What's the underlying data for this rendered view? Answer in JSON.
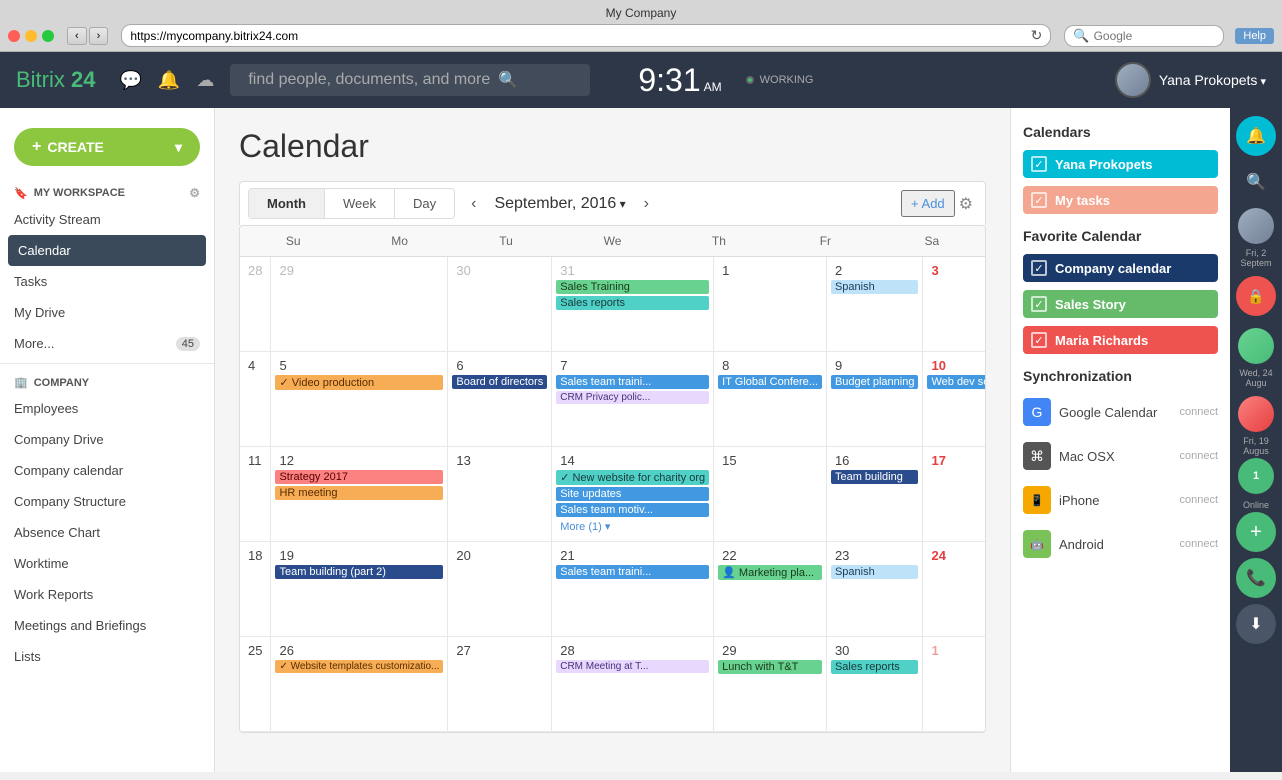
{
  "browser": {
    "title": "My Company",
    "url": "https://mycompany.bitrix24.com",
    "search_placeholder": "Google"
  },
  "header": {
    "logo_bitrix": "Bitrix",
    "logo_24": "24",
    "search_placeholder": "find people, documents, and more",
    "time": "9:31",
    "time_suffix": "AM",
    "status": "WORKING",
    "username": "Yana Prokopets",
    "help": "Help"
  },
  "sidebar": {
    "create_label": "+ CREATE",
    "my_workspace_label": "MY WORKSPACE",
    "items": [
      {
        "label": "Activity Stream",
        "active": false
      },
      {
        "label": "Calendar",
        "active": true
      },
      {
        "label": "Tasks",
        "active": false
      },
      {
        "label": "My Drive",
        "active": false
      },
      {
        "label": "More...",
        "active": false,
        "badge": "45"
      }
    ],
    "company_label": "COMPANY",
    "company_items": [
      {
        "label": "Employees"
      },
      {
        "label": "Company Drive"
      },
      {
        "label": "Company calendar"
      },
      {
        "label": "Company Structure"
      },
      {
        "label": "Absence Chart"
      },
      {
        "label": "Worktime"
      },
      {
        "label": "Work Reports"
      },
      {
        "label": "Meetings and Briefings"
      },
      {
        "label": "Lists"
      }
    ]
  },
  "page": {
    "title": "Calendar"
  },
  "calendar": {
    "view_tabs": [
      "Month",
      "Week",
      "Day"
    ],
    "active_tab": "Month",
    "month_label": "September, 2016",
    "add_label": "+ Add",
    "day_headers": [
      "Su",
      "Mo",
      "Tu",
      "We",
      "Th",
      "Fr",
      "Sa"
    ],
    "weeks": [
      {
        "days": [
          {
            "date": "28",
            "gray": true,
            "events": []
          },
          {
            "date": "29",
            "gray": true,
            "events": []
          },
          {
            "date": "30",
            "gray": true,
            "events": []
          },
          {
            "date": "31",
            "gray": true,
            "events": [
              {
                "label": "Sales Training",
                "color": "ev-green"
              },
              {
                "label": "Sales reports",
                "color": "ev-teal"
              }
            ]
          },
          {
            "date": "1",
            "events": []
          },
          {
            "date": "2",
            "events": [
              {
                "label": "Spanish",
                "color": "ev-light-blue"
              }
            ]
          },
          {
            "date": "3",
            "red": true,
            "events": []
          }
        ]
      },
      {
        "days": [
          {
            "date": "4",
            "events": []
          },
          {
            "date": "5",
            "events": [
              {
                "label": "✓ Video production",
                "color": "ev-orange"
              }
            ]
          },
          {
            "date": "6",
            "events": [
              {
                "label": "Board of directors",
                "color": "ev-navy"
              }
            ]
          },
          {
            "date": "7",
            "events": [
              {
                "label": "Sales team traini...",
                "color": "ev-blue"
              },
              {
                "label": "CRM Privacy polic...",
                "color": "ev-crm"
              }
            ]
          },
          {
            "date": "8",
            "events": [
              {
                "label": "IT Global Confere...",
                "color": "ev-blue"
              }
            ]
          },
          {
            "date": "9",
            "events": [
              {
                "label": "Budget planning",
                "color": "ev-blue"
              }
            ]
          },
          {
            "date": "10",
            "red": true,
            "events": [
              {
                "label": "Web dev seminar...",
                "color": "ev-blue"
              }
            ]
          }
        ]
      },
      {
        "days": [
          {
            "date": "11",
            "events": []
          },
          {
            "date": "12",
            "events": [
              {
                "label": "Strategy 2017",
                "color": "ev-red"
              },
              {
                "label": "HR meeting",
                "color": "ev-orange"
              }
            ]
          },
          {
            "date": "13",
            "events": []
          },
          {
            "date": "14",
            "events": [
              {
                "label": "✓ New website for charity org",
                "color": "ev-teal"
              },
              {
                "label": "Site updates",
                "color": "ev-blue"
              },
              {
                "label": "Sales team motiv...",
                "color": "ev-blue"
              },
              {
                "label": "More (1)",
                "color": "ev-more"
              }
            ]
          },
          {
            "date": "15",
            "events": []
          },
          {
            "date": "16",
            "events": [
              {
                "label": "Team building",
                "color": "ev-navy"
              }
            ]
          },
          {
            "date": "17",
            "red": true,
            "events": []
          }
        ]
      },
      {
        "days": [
          {
            "date": "18",
            "events": []
          },
          {
            "date": "19",
            "events": [
              {
                "label": "Team building (part 2)",
                "color": "ev-navy"
              }
            ]
          },
          {
            "date": "20",
            "events": []
          },
          {
            "date": "21",
            "events": [
              {
                "label": "Sales team traini...",
                "color": "ev-blue"
              }
            ]
          },
          {
            "date": "22",
            "events": [
              {
                "label": "👤 Marketing pla...",
                "color": "ev-green"
              }
            ]
          },
          {
            "date": "23",
            "events": [
              {
                "label": "Spanish",
                "color": "ev-light-blue"
              }
            ]
          },
          {
            "date": "24",
            "red": true,
            "events": []
          }
        ]
      },
      {
        "days": [
          {
            "date": "25",
            "events": []
          },
          {
            "date": "26",
            "events": [
              {
                "label": "✓ Website templates customizatio...",
                "color": "ev-orange"
              }
            ]
          },
          {
            "date": "27",
            "events": []
          },
          {
            "date": "28",
            "events": [
              {
                "label": "CRM Meeting at T...",
                "color": "ev-crm"
              }
            ]
          },
          {
            "date": "29",
            "events": [
              {
                "label": "Lunch with T&T",
                "color": "ev-green"
              }
            ]
          },
          {
            "date": "30",
            "events": [
              {
                "label": "Sales reports",
                "color": "ev-teal"
              }
            ]
          },
          {
            "date": "1",
            "gray": true,
            "red": true,
            "events": []
          }
        ]
      }
    ]
  },
  "right_panel": {
    "calendars_title": "Calendars",
    "calendars": [
      {
        "label": "Yana Prokopets",
        "color": "ci-cyan"
      },
      {
        "label": "My tasks",
        "color": "ci-salmon"
      }
    ],
    "favorite_title": "Favorite Calendar",
    "favorites": [
      {
        "label": "Company calendar",
        "color": "ci-navy"
      },
      {
        "label": "Sales Story",
        "color": "ci-green"
      },
      {
        "label": "Maria Richards",
        "color": "ci-red"
      }
    ],
    "sync_title": "Synchronization",
    "sync_items": [
      {
        "label": "Google Calendar",
        "connect": "connect",
        "icon_class": "sync-google",
        "icon": "G"
      },
      {
        "label": "Mac OSX",
        "connect": "connect",
        "icon_class": "sync-mac",
        "icon": "⌘"
      },
      {
        "label": "iPhone",
        "connect": "connect",
        "icon_class": "sync-iphone",
        "icon": "📱"
      },
      {
        "label": "Android",
        "connect": "connect",
        "icon_class": "sync-android",
        "icon": "🤖"
      }
    ]
  },
  "far_right": {
    "dates": [
      {
        "label": "Fri, 2 Septem"
      },
      {
        "label": "Wed, 24 Augu"
      },
      {
        "label": "Fri, 19 Augus"
      }
    ],
    "online_label": "Online"
  }
}
